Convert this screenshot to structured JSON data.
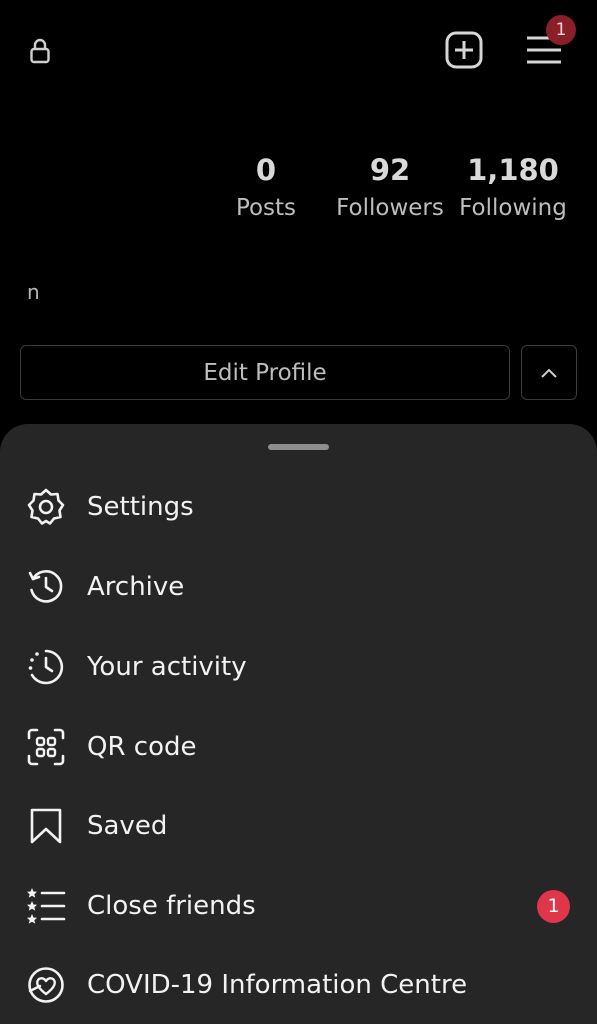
{
  "header": {
    "menu_badge": "1"
  },
  "stats": {
    "posts": {
      "value": "0",
      "label": "Posts"
    },
    "followers": {
      "value": "92",
      "label": "Followers"
    },
    "following": {
      "value": "1,180",
      "label": "Following"
    }
  },
  "profile": {
    "name": "n",
    "edit_label": "Edit Profile"
  },
  "sheet": {
    "items": [
      {
        "label": "Settings",
        "icon": "gear-icon"
      },
      {
        "label": "Archive",
        "icon": "archive-icon"
      },
      {
        "label": "Your activity",
        "icon": "activity-icon"
      },
      {
        "label": "QR code",
        "icon": "qr-code-icon"
      },
      {
        "label": "Saved",
        "icon": "bookmark-icon"
      },
      {
        "label": "Close friends",
        "icon": "close-friends-icon",
        "badge": "1"
      },
      {
        "label": "COVID-19 Information Centre",
        "icon": "covid-info-icon"
      }
    ]
  },
  "colors": {
    "background": "#000000",
    "sheet": "#262626",
    "badge": "#e0364a",
    "menu_badge": "#8a1f2a"
  }
}
